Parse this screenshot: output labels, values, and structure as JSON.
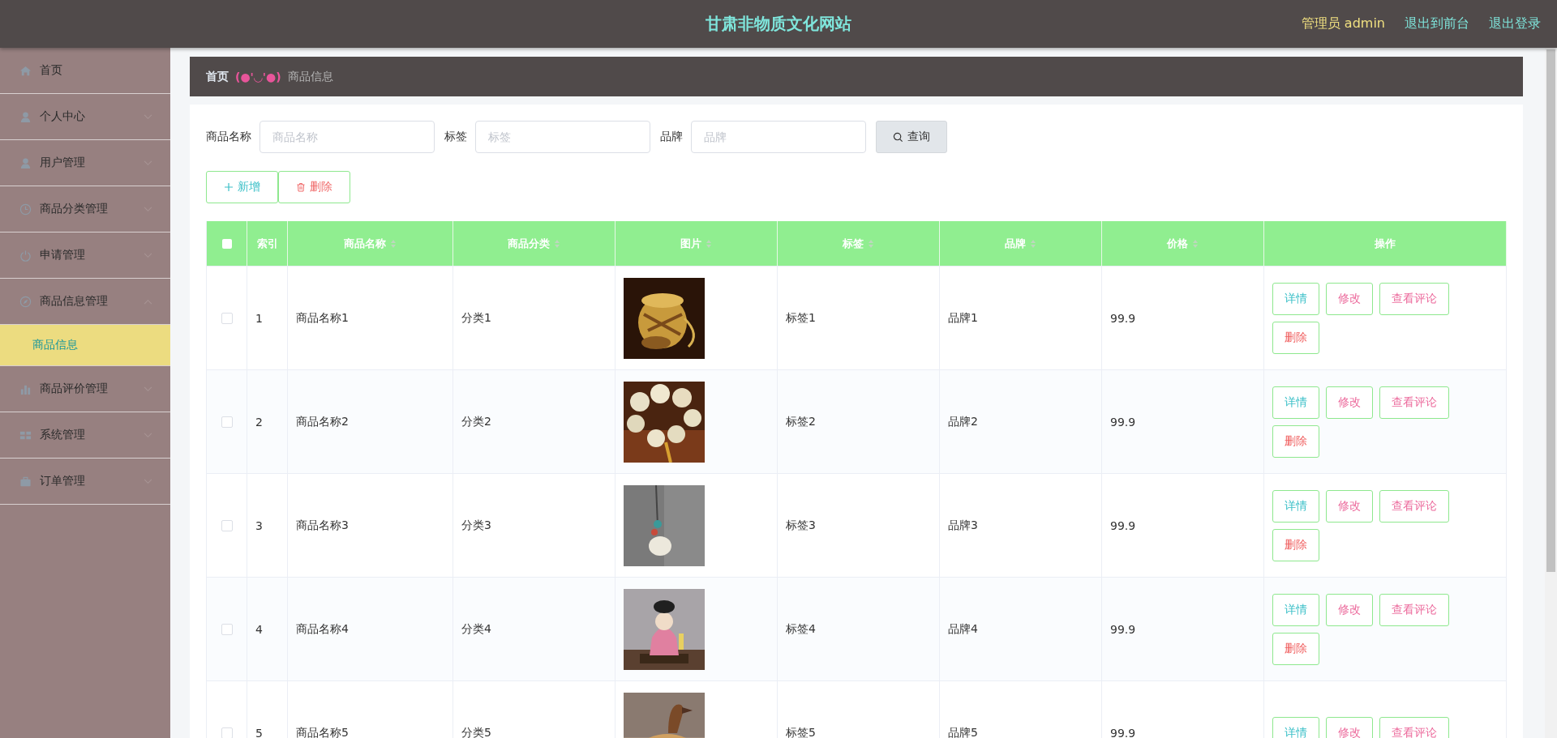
{
  "header": {
    "title": "甘肃非物质文化网站",
    "user": "管理员 admin",
    "links": [
      "退出到前台",
      "退出登录"
    ]
  },
  "sidebar": {
    "items": [
      {
        "label": "首页",
        "kind": "link"
      },
      {
        "label": "个人中心",
        "kind": "submenu",
        "expanded": false
      },
      {
        "label": "用户管理",
        "kind": "submenu",
        "expanded": false
      },
      {
        "label": "商品分类管理",
        "kind": "submenu",
        "expanded": false
      },
      {
        "label": "申请管理",
        "kind": "submenu",
        "expanded": false
      },
      {
        "label": "商品信息管理",
        "kind": "submenu",
        "expanded": true,
        "children": [
          {
            "label": "商品信息",
            "selected": true
          }
        ]
      },
      {
        "label": "商品评价管理",
        "kind": "submenu",
        "expanded": false
      },
      {
        "label": "系统管理",
        "kind": "submenu",
        "expanded": false
      },
      {
        "label": "订单管理",
        "kind": "submenu",
        "expanded": false
      }
    ]
  },
  "breadcrumb": {
    "home": "首页",
    "separator": "(●'◡'●)",
    "current": "商品信息"
  },
  "search": {
    "fields": [
      {
        "label": "商品名称",
        "placeholder": "商品名称"
      },
      {
        "label": "标签",
        "placeholder": "标签"
      },
      {
        "label": "品牌",
        "placeholder": "品牌"
      }
    ],
    "button": "查询"
  },
  "actions": [
    {
      "label": "新增",
      "kind": "add"
    },
    {
      "label": "删除",
      "kind": "delete"
    }
  ],
  "table": {
    "select_all": false,
    "columns": [
      {
        "label": "索引",
        "sortable": false
      },
      {
        "label": "商品名称",
        "sortable": true
      },
      {
        "label": "商品分类",
        "sortable": true
      },
      {
        "label": "图片",
        "sortable": true
      },
      {
        "label": "标签",
        "sortable": true
      },
      {
        "label": "品牌",
        "sortable": true
      },
      {
        "label": "价格",
        "sortable": true
      },
      {
        "label": "操作",
        "sortable": false
      }
    ],
    "rows": [
      {
        "checked": false,
        "index": "1",
        "name": "商品名称1",
        "category": "分类1",
        "tag": "标签1",
        "brand": "品牌1",
        "price": "99.9",
        "buttons": [
          {
            "label": "详情",
            "kind": "detail"
          },
          {
            "label": "修改",
            "kind": "edit"
          },
          {
            "label": "查看评论",
            "kind": "reviews"
          },
          {
            "label": "删除",
            "kind": "delete"
          }
        ]
      },
      {
        "checked": false,
        "index": "2",
        "name": "商品名称2",
        "category": "分类2",
        "tag": "标签2",
        "brand": "品牌2",
        "price": "99.9",
        "buttons": [
          {
            "label": "详情",
            "kind": "detail"
          },
          {
            "label": "修改",
            "kind": "edit"
          },
          {
            "label": "查看评论",
            "kind": "reviews"
          },
          {
            "label": "删除",
            "kind": "delete"
          }
        ]
      },
      {
        "checked": false,
        "index": "3",
        "name": "商品名称3",
        "category": "分类3",
        "tag": "标签3",
        "brand": "品牌3",
        "price": "99.9",
        "buttons": [
          {
            "label": "详情",
            "kind": "detail"
          },
          {
            "label": "修改",
            "kind": "edit"
          },
          {
            "label": "查看评论",
            "kind": "reviews"
          },
          {
            "label": "删除",
            "kind": "delete"
          }
        ]
      },
      {
        "checked": false,
        "index": "4",
        "name": "商品名称4",
        "category": "分类4",
        "tag": "标签4",
        "brand": "品牌4",
        "price": "99.9",
        "buttons": [
          {
            "label": "详情",
            "kind": "detail"
          },
          {
            "label": "修改",
            "kind": "edit"
          },
          {
            "label": "查看评论",
            "kind": "reviews"
          },
          {
            "label": "删除",
            "kind": "delete"
          }
        ]
      },
      {
        "checked": false,
        "index": "5",
        "name": "商品名称5",
        "category": "分类5",
        "tag": "标签5",
        "brand": "品牌5",
        "price": "99.9",
        "buttons": [
          {
            "label": "详情",
            "kind": "detail"
          },
          {
            "label": "修改",
            "kind": "edit"
          },
          {
            "label": "查看评论",
            "kind": "reviews"
          }
        ]
      }
    ]
  }
}
